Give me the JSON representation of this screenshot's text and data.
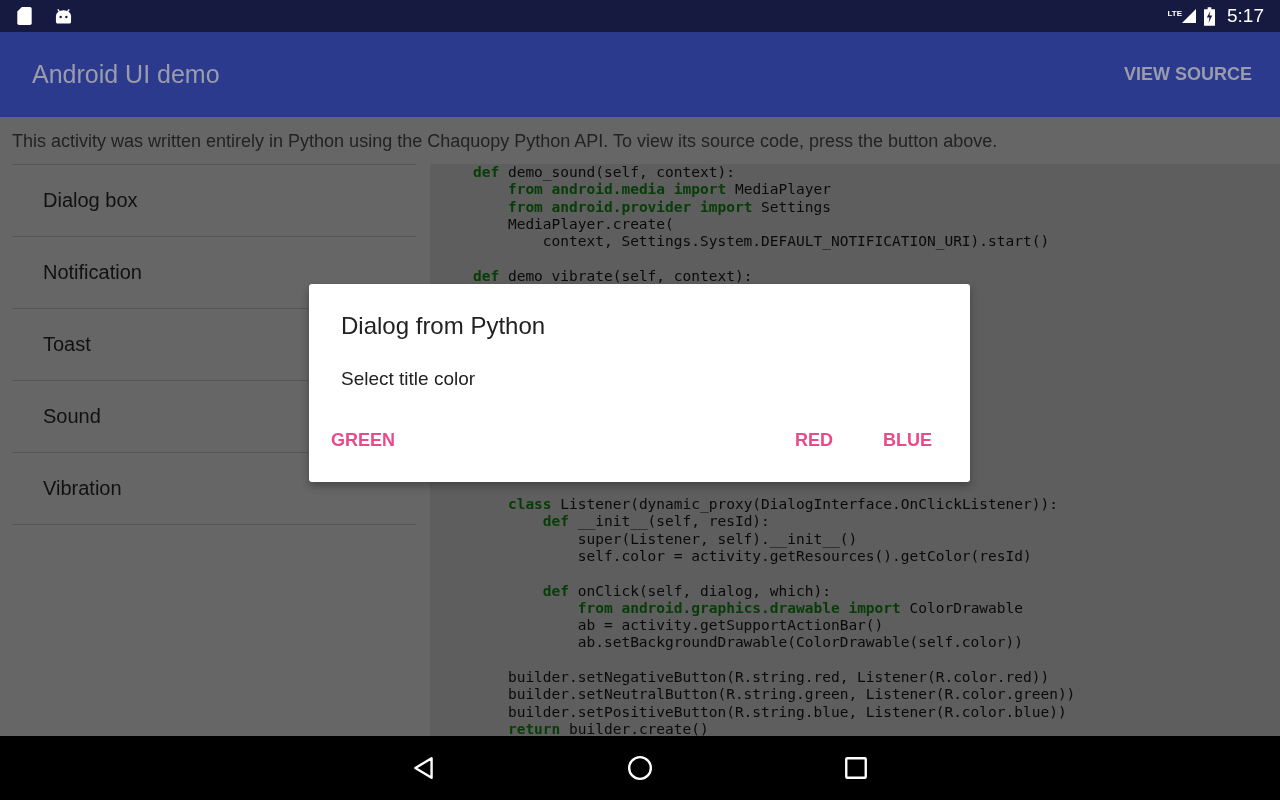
{
  "status_bar": {
    "network": "LTE",
    "time": "5:17"
  },
  "app_bar": {
    "title": "Android UI demo",
    "action": "VIEW SOURCE"
  },
  "description": "This activity was written entirely in Python using the Chaquopy Python API. To view its source code, press the button above.",
  "demos": [
    {
      "label": "Dialog box"
    },
    {
      "label": "Notification"
    },
    {
      "label": "Toast"
    },
    {
      "label": "Sound"
    },
    {
      "label": "Vibration"
    }
  ],
  "source_code": [
    [
      "**def** demo_sound(self, context):",
      "    **from** **android.media** **import** MediaPlayer",
      "    **from** **android.provider** **import** Settings",
      "    MediaPlayer.create(",
      "        context, Settings.System.DEFAULT_NOTIFICATION_URI).start()"
    ],
    [
      "**def** demo_vibrate(self, context):"
    ],
    [
      "    **class** Listener(dynamic_proxy(DialogInterface.OnClickListener)):",
      "        **def** __init__(self, resId):",
      "            super(Listener, self).__init__()",
      "            self.color = activity.getResources().getColor(resId)"
    ],
    [
      "        **def** onClick(self, dialog, which):",
      "            **from** **android.graphics.drawable** **import** ColorDrawable",
      "            ab = activity.getSupportActionBar()",
      "            ab.setBackgroundDrawable(ColorDrawable(self.color))"
    ],
    [
      "    builder.setNegativeButton(R.string.red, Listener(R.color.red))",
      "    builder.setNeutralButton(R.string.green, Listener(R.color.green))",
      "    builder.setPositiveButton(R.string.blue, Listener(R.color.blue))",
      "    **return** builder.create()"
    ]
  ],
  "dialog": {
    "title": "Dialog from Python",
    "message": "Select title color",
    "neutral_button": "GREEN",
    "buttons": [
      "RED",
      "BLUE"
    ]
  }
}
